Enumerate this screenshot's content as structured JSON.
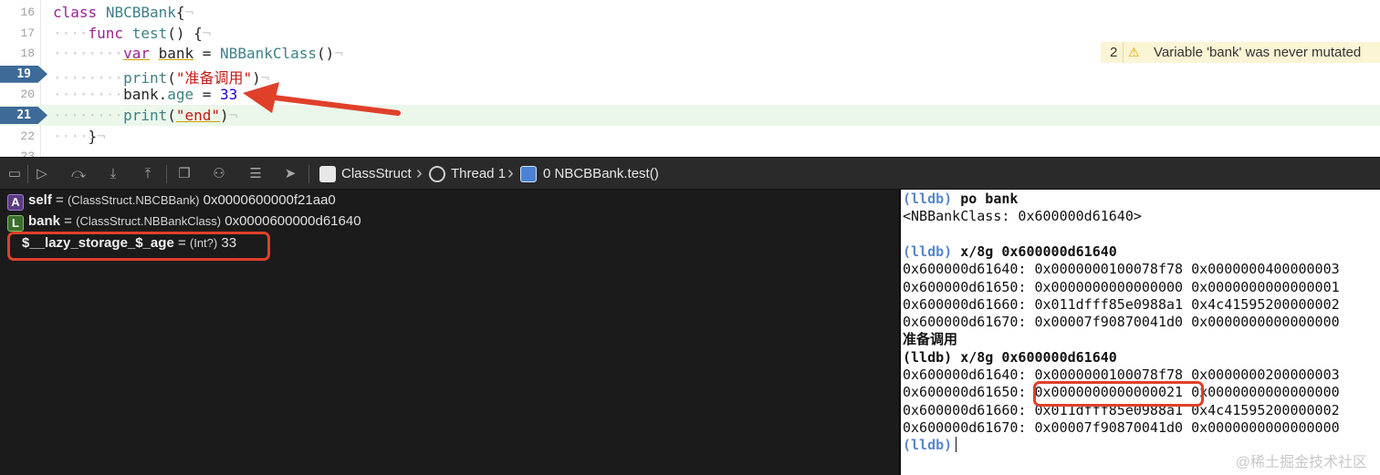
{
  "editor": {
    "lines": [
      {
        "num": "16",
        "tokens": [
          {
            "t": "class",
            "c": "kw"
          },
          {
            "t": " "
          },
          {
            "t": "NBCBBank",
            "c": "cls"
          },
          {
            "t": "{"
          },
          {
            "t": "¬",
            "c": "ws"
          }
        ]
      },
      {
        "num": "17",
        "tokens": [
          {
            "t": "····",
            "c": "ws"
          },
          {
            "t": "func",
            "c": "kw"
          },
          {
            "t": " "
          },
          {
            "t": "test",
            "c": "fn"
          },
          {
            "t": "() {"
          },
          {
            "t": "¬",
            "c": "ws"
          }
        ]
      },
      {
        "num": "18",
        "tokens": [
          {
            "t": "········",
            "c": "ws"
          },
          {
            "t": "var",
            "c": "kw under"
          },
          {
            "t": " "
          },
          {
            "t": "bank",
            "c": "under"
          },
          {
            "t": " = "
          },
          {
            "t": "NBBankClass",
            "c": "cls"
          },
          {
            "t": "()"
          },
          {
            "t": "¬",
            "c": "ws"
          }
        ]
      },
      {
        "num": "19",
        "breakpoint": true,
        "tokens": [
          {
            "t": "········",
            "c": "ws"
          },
          {
            "t": "print",
            "c": "fn"
          },
          {
            "t": "("
          },
          {
            "t": "\"准备调用\"",
            "c": "str"
          },
          {
            "t": ")"
          },
          {
            "t": "¬",
            "c": "ws"
          }
        ]
      },
      {
        "num": "20",
        "tokens": [
          {
            "t": "········",
            "c": "ws"
          },
          {
            "t": "bank"
          },
          {
            "t": "."
          },
          {
            "t": "age",
            "c": "prop"
          },
          {
            "t": " = "
          },
          {
            "t": "33",
            "c": "num"
          }
        ]
      },
      {
        "num": "21",
        "breakpoint": true,
        "highlight": true,
        "tokens": [
          {
            "t": "········",
            "c": "ws"
          },
          {
            "t": "print",
            "c": "fn"
          },
          {
            "t": "("
          },
          {
            "t": "\"end\"",
            "c": "str under"
          },
          {
            "t": ")"
          },
          {
            "t": "¬",
            "c": "ws"
          }
        ]
      },
      {
        "num": "22",
        "tokens": [
          {
            "t": "····",
            "c": "ws"
          },
          {
            "t": "}"
          },
          {
            "t": "¬",
            "c": "ws"
          }
        ]
      },
      {
        "num": "23",
        "tokens": []
      }
    ],
    "warning": {
      "count": "2",
      "icon": "warning-triangle-icon",
      "text": "Variable 'bank' was never mutated"
    }
  },
  "toolbar": {
    "icons": [
      "console-toggle-icon",
      "continue-icon",
      "step-over-icon",
      "step-into-icon",
      "step-out-icon",
      "view-hierarchy-icon",
      "memory-graph-icon",
      "environment-overrides-icon",
      "location-icon"
    ],
    "breadcrumbs": [
      {
        "label": "ClassStruct",
        "icon": "app-icon"
      },
      {
        "label": "Thread 1",
        "icon": "thread-icon"
      },
      {
        "label": "0 NBCBBank.test()",
        "icon": "frame-icon"
      }
    ]
  },
  "variables": [
    {
      "badge": "A",
      "name": "self",
      "eq": " = ",
      "type": "(ClassStruct.NBCBBank)",
      "value": " 0x0000600000f21aa0"
    },
    {
      "badge": "L",
      "name": "bank",
      "eq": " = ",
      "type": "(ClassStruct.NBBankClass)",
      "value": " 0x0000600000d61640"
    },
    {
      "badge": "",
      "name": "$__lazy_storage_$_age",
      "eq": " = ",
      "type": "(Int?)",
      "value": " 33"
    }
  ],
  "console": {
    "lines": [
      {
        "prompt": "(lldb)",
        "cmd": " po bank"
      },
      {
        "text": "<NBBankClass: 0x600000d61640>"
      },
      {
        "text": ""
      },
      {
        "prompt": "(lldb)",
        "cmd": " x/8g 0x600000d61640"
      },
      {
        "text": "0x600000d61640: 0x0000000100078f78 0x0000000400000003"
      },
      {
        "text": "0x600000d61650: 0x0000000000000000 0x0000000000000001"
      },
      {
        "text": "0x600000d61660: 0x011dfff85e0988a1 0x4c41595200000002"
      },
      {
        "text": "0x600000d61670: 0x00007f90870041d0 0x0000000000000000"
      },
      {
        "text": "准备调用",
        "bold": true
      },
      {
        "plainprompt": "(lldb)",
        "cmd": " x/8g 0x600000d61640"
      },
      {
        "text": "0x600000d61640: 0x0000000100078f78 0x0000000200000003"
      },
      {
        "text": "0x600000d61650: 0x0000000000000021 0x0000000000000000"
      },
      {
        "text": "0x600000d61660: 0x011dfff85e0988a1 0x4c41595200000002"
      },
      {
        "text": "0x600000d61670: 0x00007f90870041d0 0x0000000000000000"
      },
      {
        "prompt": "(lldb)",
        "cmd": "",
        "cursor": true
      }
    ],
    "watermark": "@稀土掘金技术社区"
  },
  "colors": {
    "annotation_red": "#e0402a",
    "breakpoint_blue": "#3d6a96",
    "lldb_prompt": "#5a86c8"
  }
}
